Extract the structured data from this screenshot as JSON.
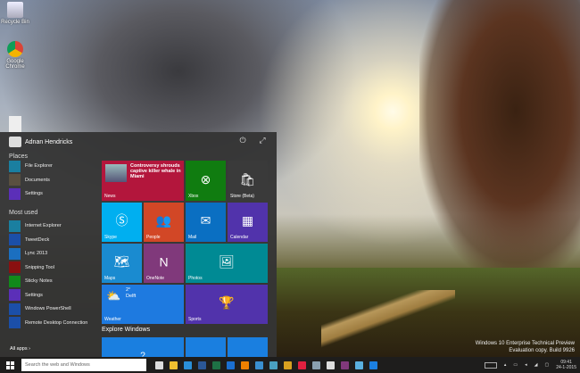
{
  "desktop": {
    "icons": [
      {
        "label": "Recycle Bin"
      },
      {
        "label": "Google Chrome"
      }
    ],
    "watermark": [
      "Windows 10 Enterprise Technical Preview",
      "Evaluation copy. Build 9926"
    ]
  },
  "start": {
    "user": "Adnan Hendricks",
    "places_heading": "Places",
    "places": [
      {
        "label": "File Explorer",
        "color": "#1a7fa0"
      },
      {
        "label": "Documents",
        "color": "#5a5040"
      },
      {
        "label": "Settings",
        "color": "#5b2fb8"
      }
    ],
    "most_used_heading": "Most used",
    "most_used": [
      {
        "label": "Internet Explorer",
        "color": "#1a7fa0"
      },
      {
        "label": "TweetDeck",
        "color": "#1b4fa8"
      },
      {
        "label": "Lync 2013",
        "color": "#1b6fc0"
      },
      {
        "label": "Snipping Tool",
        "color": "#8a1010"
      },
      {
        "label": "Sticky Notes",
        "color": "#118a1a"
      },
      {
        "label": "Settings",
        "color": "#5b2fb8"
      },
      {
        "label": "Windows PowerShell",
        "color": "#1b4fa8"
      },
      {
        "label": "Remote Desktop Connection",
        "color": "#1b4fa8"
      }
    ],
    "all_apps": "All apps ›",
    "tiles": {
      "news": {
        "label": "News",
        "headline": "Controversy shrouds captive killer whale in Miami"
      },
      "xbox": "Xbox",
      "store": "Store (Beta)",
      "skype": "Skype",
      "people": "People",
      "mail": "Mail",
      "calendar": "Calendar",
      "maps": "Maps",
      "onenote": "OneNote",
      "photos": "Photos",
      "weather": {
        "label": "Weather",
        "temp": "2°",
        "city": "Delft"
      },
      "sports": "Sports"
    },
    "explore_heading": "Explore Windows"
  },
  "taskbar": {
    "search_placeholder": "Search the web and Windows",
    "apps": [
      {
        "name": "task-view",
        "color": "#ddd"
      },
      {
        "name": "file-explorer",
        "color": "#f0c030"
      },
      {
        "name": "internet-explorer",
        "color": "#2a8fd8"
      },
      {
        "name": "word",
        "color": "#2b5797"
      },
      {
        "name": "excel",
        "color": "#1e7145"
      },
      {
        "name": "tweetdeck",
        "color": "#1b6fd0"
      },
      {
        "name": "vlc",
        "color": "#f08000"
      },
      {
        "name": "app-blue",
        "color": "#3a8fd0"
      },
      {
        "name": "files",
        "color": "#4aa0c0"
      },
      {
        "name": "chrome",
        "color": "#d8a020"
      },
      {
        "name": "itunes",
        "color": "#e02040"
      },
      {
        "name": "app-grey",
        "color": "#8aa0b0"
      },
      {
        "name": "app-white",
        "color": "#ddd"
      },
      {
        "name": "onenote",
        "color": "#80397b"
      },
      {
        "name": "remote-desktop",
        "color": "#5ab0e0"
      },
      {
        "name": "app-active",
        "color": "#1b7fe0"
      }
    ],
    "time": "09:41",
    "date": "24-1-2015"
  }
}
